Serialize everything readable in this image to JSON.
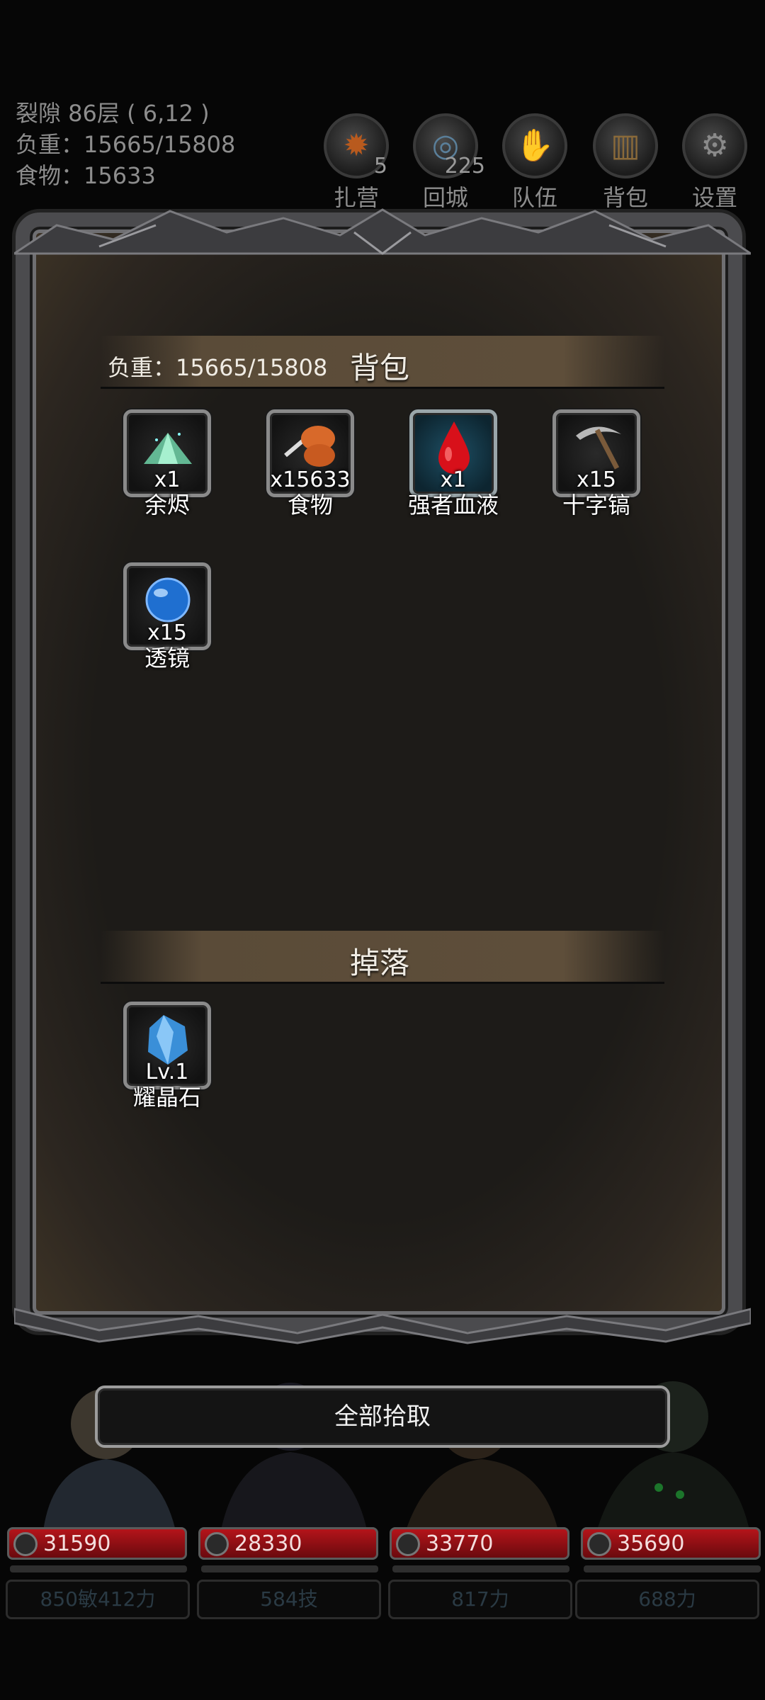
{
  "hud": {
    "location": "裂隙 86层 ( 6,12 )",
    "weight": "负重：15665/15808",
    "food": "食物：15633",
    "buttons": [
      {
        "label": "扎营",
        "count": "5",
        "icon": "campfire-icon"
      },
      {
        "label": "回城",
        "count": "225",
        "icon": "portal-icon"
      },
      {
        "label": "队伍",
        "count": "",
        "icon": "team-hand-icon"
      },
      {
        "label": "背包",
        "count": "",
        "icon": "barrel-icon"
      },
      {
        "label": "设置",
        "count": "",
        "icon": "gear-icon"
      }
    ]
  },
  "backpack": {
    "title": "背包",
    "weight": "负重：15665/15808",
    "items": [
      {
        "name": "余烬",
        "qty": "x1",
        "icon": "ember-icon"
      },
      {
        "name": "食物",
        "qty": "x15633",
        "icon": "meat-icon"
      },
      {
        "name": "强者血液",
        "qty": "x1",
        "icon": "blood-drop-icon"
      },
      {
        "name": "十字镐",
        "qty": "x15",
        "icon": "pickaxe-icon"
      },
      {
        "name": "透镜",
        "qty": "x15",
        "icon": "lens-orb-icon"
      }
    ]
  },
  "drops": {
    "title": "掉落",
    "items": [
      {
        "name": "耀晶石",
        "qty": "Lv.1",
        "icon": "crystal-icon"
      }
    ]
  },
  "pickup_all": "全部拾取",
  "team": [
    {
      "hp": "31590",
      "stat": "850敏412力"
    },
    {
      "hp": "28330",
      "stat": "584技"
    },
    {
      "hp": "33770",
      "stat": "817力"
    },
    {
      "hp": "35690",
      "stat": "688力"
    }
  ],
  "colors": {
    "hp_bar": "#b4141a",
    "frame": "#4b4b4e",
    "panel": "#1d1b18",
    "section_bar": "#5a4b38"
  }
}
